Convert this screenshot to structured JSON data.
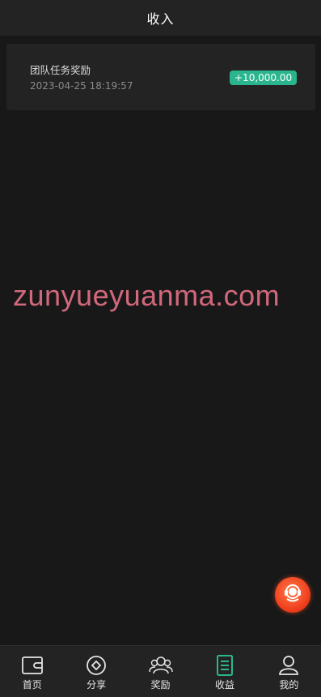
{
  "header": {
    "title": "收入"
  },
  "records": [
    {
      "name": "团队任务奖励",
      "time": "2023-04-25 18:19:57",
      "amount": "+10,000.00"
    }
  ],
  "watermark": "zunyueyuanma.com",
  "float_button": {
    "icon": "customer-service-icon"
  },
  "colors": {
    "background": "#181818",
    "card": "#232323",
    "accent": "#2bb58f",
    "watermark": "#d2687b",
    "float_button": "#f0421f"
  },
  "tabbar": {
    "items": [
      {
        "label": "首页",
        "icon": "wallet-icon",
        "active": false
      },
      {
        "label": "分享",
        "icon": "diamond-circle-icon",
        "active": false
      },
      {
        "label": "奖励",
        "icon": "users-icon",
        "active": false
      },
      {
        "label": "收益",
        "icon": "document-list-icon",
        "active": true
      },
      {
        "label": "我的",
        "icon": "user-icon",
        "active": false
      }
    ]
  }
}
